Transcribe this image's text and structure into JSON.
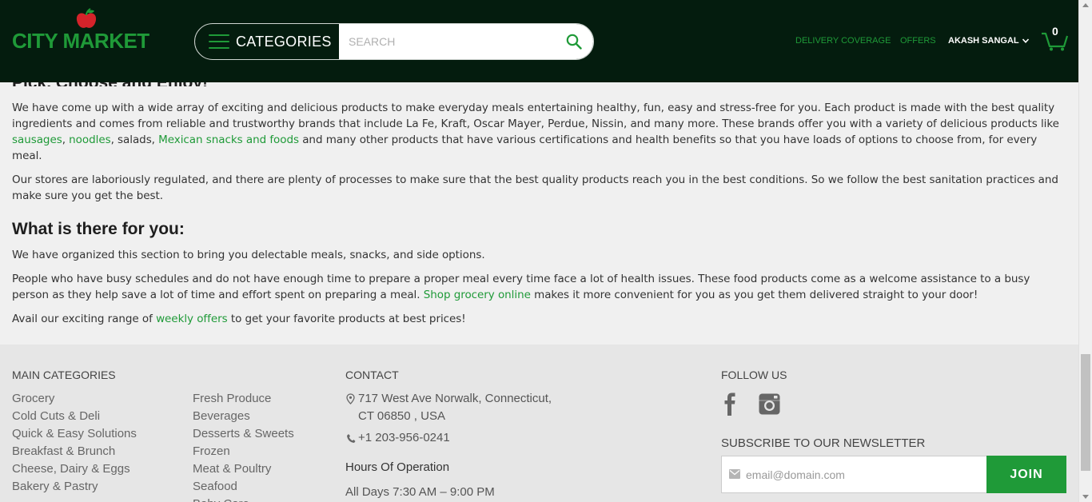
{
  "header": {
    "logo_text": "CITY MARKET",
    "categories_label": "CATEGORIES",
    "search_placeholder": "SEARCH",
    "nav": {
      "delivery": "DELIVERY COVERAGE",
      "offers": "OFFERS",
      "user": "AKASH SANGAL"
    },
    "cart_count": "0"
  },
  "content": {
    "heading1": "Pick, Choose and Enjoy!",
    "p1_a": "We have come up with a wide array of exciting and delicious products to make everyday meals entertaining healthy, fun, easy and stress-free for you. Each product is made with the best quality ingredients and comes from reliable and trustworthy brands that include La Fe, Kraft, Oscar Mayer, Perdue, Nissin, and many more. These brands offer you with a variety of delicious products like ",
    "p1_link1": "sausages",
    "p1_sep1": ", ",
    "p1_link2": "noodles",
    "p1_b": ", salads, ",
    "p1_link3": "Mexican snacks and foods",
    "p1_c": " and many other products that have various certifications and health benefits so that you have loads of options to choose from, for every meal.",
    "p2": "Our stores are laboriously regulated, and there are plenty of processes to make sure that the best quality products reach you in the best conditions. So we follow the best sanitation practices and make sure you get the best.",
    "heading2": "What is there for you:",
    "p3": "We have organized this section to bring you delectable meals, snacks, and side options.",
    "p4_a": "People who have busy schedules and do not have enough time to prepare a proper meal every time face a lot of health issues. These food products come as a welcome assistance to a busy person as they help save a lot of time and effort spent on preparing a meal. ",
    "p4_link": "Shop grocery online",
    "p4_b": " makes it more convenient for you as you get them delivered straight to your door!",
    "p5_a": "Avail our exciting range of ",
    "p5_link": "weekly offers",
    "p5_b": " to get your favorite products at best prices!"
  },
  "footer": {
    "main_categories_title": "MAIN CATEGORIES",
    "col1": [
      "Grocery",
      "Cold Cuts & Deli",
      "Quick & Easy Solutions",
      "Breakfast & Brunch",
      "Cheese, Dairy & Eggs",
      "Bakery & Pastry"
    ],
    "col2": [
      "Fresh Produce",
      "Beverages",
      "Desserts & Sweets",
      "Frozen",
      "Meat & Poultry",
      "Seafood",
      "Baby Care"
    ],
    "contact_title": "CONTACT",
    "address_line1": "717 West Ave Norwalk, Connecticut,",
    "address_line2": "CT 06850 , USA",
    "phone": "+1 203-956-0241",
    "hours_title": "Hours Of Operation",
    "hours": "All Days 7:30 AM – 9:00 PM",
    "follow_title": "FOLLOW US",
    "newsletter_title": "SUBSCRIBE TO OUR NEWSLETTER",
    "email_placeholder": "email@domain.com",
    "join_label": "JOIN"
  },
  "colors": {
    "header_bg": "#041c0e",
    "accent_green": "#1f9a38",
    "logo_apple_red": "#d4232a"
  },
  "icons": [
    "hamburger-icon",
    "search-icon",
    "chevron-down-icon",
    "cart-icon",
    "location-pin-icon",
    "phone-icon",
    "facebook-icon",
    "instagram-icon",
    "mail-icon"
  ]
}
